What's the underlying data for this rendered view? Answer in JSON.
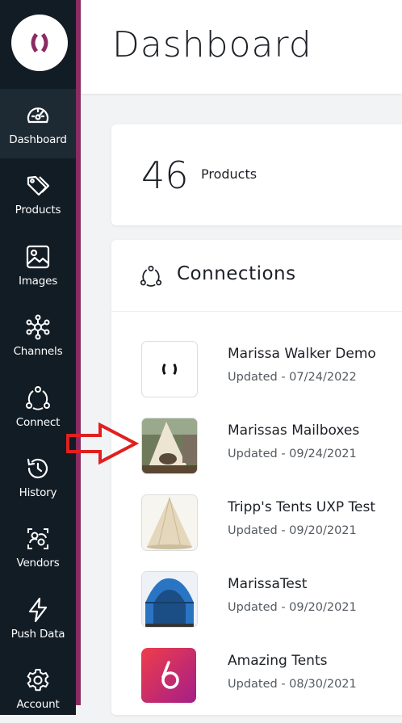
{
  "app": {
    "title": "Dashboard"
  },
  "sidebar": {
    "logo": "brand-logo",
    "items": [
      {
        "label": "Dashboard",
        "icon": "gauge-icon",
        "active": true
      },
      {
        "label": "Products",
        "icon": "tags-icon"
      },
      {
        "label": "Images",
        "icon": "image-icon"
      },
      {
        "label": "Channels",
        "icon": "network-icon"
      },
      {
        "label": "Connect",
        "icon": "connect-cycle-icon"
      },
      {
        "label": "History",
        "icon": "history-icon"
      },
      {
        "label": "Vendors",
        "icon": "vendors-icon"
      },
      {
        "label": "Push Data",
        "icon": "lightning-icon"
      },
      {
        "label": "Account",
        "icon": "gear-icon"
      }
    ]
  },
  "summary": {
    "products_count": "46",
    "products_label": "Products"
  },
  "connections": {
    "title": "Connections",
    "icon": "connect-cycle-icon",
    "items": [
      {
        "name": "Marissa Walker Demo",
        "updated": "Updated - 07/24/2022",
        "thumb": "brand-logo"
      },
      {
        "name": "Marissas Mailboxes",
        "updated": "Updated - 09/24/2021",
        "thumb": "tent-photo"
      },
      {
        "name": "Tripp's Tents UXP Test",
        "updated": "Updated - 09/20/2021",
        "thumb": "tent-photo"
      },
      {
        "name": "MarissaTest",
        "updated": "Updated - 09/20/2021",
        "thumb": "tent-photo"
      },
      {
        "name": "Amazing Tents",
        "updated": "Updated - 08/30/2021",
        "thumb": "app-logo"
      }
    ]
  },
  "colors": {
    "sidebar": "#121c24",
    "accent": "#8a2c63",
    "arrow": "#e02020"
  }
}
